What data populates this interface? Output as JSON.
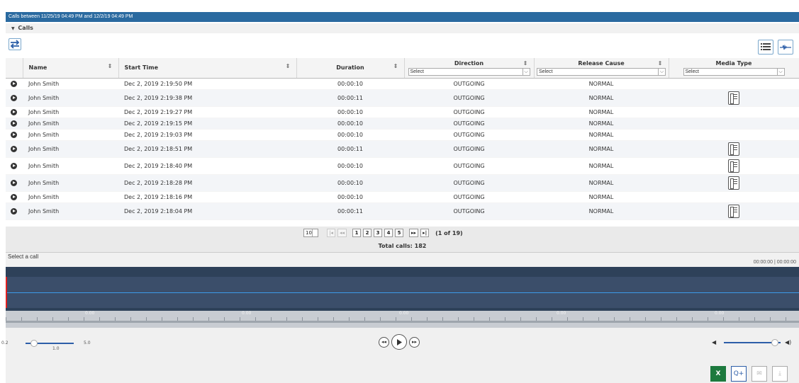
{
  "header": {
    "title": "Calls between 11/25/19 04:49 PM and 12/2/19 04:49 PM"
  },
  "section": {
    "label": "Calls"
  },
  "columns": {
    "name": "Name",
    "start_time": "Start Time",
    "duration": "Duration",
    "direction": "Direction",
    "release_cause": "Release Cause",
    "media_type": "Media Type"
  },
  "filters": {
    "direction": "Select",
    "release_cause": "Select",
    "media_type": "Select"
  },
  "rows": [
    {
      "name": "John Smith",
      "start": "Dec 2, 2019 2:19:50 PM",
      "duration": "00:00:10",
      "direction": "OUTGOING",
      "cause": "NORMAL",
      "media": ""
    },
    {
      "name": "John Smith",
      "start": "Dec 2, 2019 2:19:38 PM",
      "duration": "00:00:11",
      "direction": "OUTGOING",
      "cause": "NORMAL",
      "media": "phone-icon"
    },
    {
      "name": "John Smith",
      "start": "Dec 2, 2019 2:19:27 PM",
      "duration": "00:00:10",
      "direction": "OUTGOING",
      "cause": "NORMAL",
      "media": ""
    },
    {
      "name": "John Smith",
      "start": "Dec 2, 2019 2:19:15 PM",
      "duration": "00:00:10",
      "direction": "OUTGOING",
      "cause": "NORMAL",
      "media": ""
    },
    {
      "name": "John Smith",
      "start": "Dec 2, 2019 2:19:03 PM",
      "duration": "00:00:10",
      "direction": "OUTGOING",
      "cause": "NORMAL",
      "media": ""
    },
    {
      "name": "John Smith",
      "start": "Dec 2, 2019 2:18:51 PM",
      "duration": "00:00:11",
      "direction": "OUTGOING",
      "cause": "NORMAL",
      "media": "phone-icon"
    },
    {
      "name": "John Smith",
      "start": "Dec 2, 2019 2:18:40 PM",
      "duration": "00:00:10",
      "direction": "OUTGOING",
      "cause": "NORMAL",
      "media": "phone-icon"
    },
    {
      "name": "John Smith",
      "start": "Dec 2, 2019 2:18:28 PM",
      "duration": "00:00:10",
      "direction": "OUTGOING",
      "cause": "NORMAL",
      "media": "phone-icon"
    },
    {
      "name": "John Smith",
      "start": "Dec 2, 2019 2:18:16 PM",
      "duration": "00:00:10",
      "direction": "OUTGOING",
      "cause": "NORMAL",
      "media": ""
    },
    {
      "name": "John Smith",
      "start": "Dec 2, 2019 2:18:04 PM",
      "duration": "00:00:11",
      "direction": "OUTGOING",
      "cause": "NORMAL",
      "media": "phone-icon"
    }
  ],
  "pager": {
    "page_size": "10",
    "first": "|◂",
    "prev": "◂◂",
    "pages": [
      "1",
      "2",
      "3",
      "4",
      "5"
    ],
    "next": "▸▸",
    "last": "▸|",
    "info": "(1 of 19)",
    "total": "Total calls: 182"
  },
  "player": {
    "status": "Select a call",
    "time": "00:00:00 | 00:00:00",
    "ruler_labels": [
      "0.00",
      "0.00",
      "0.00",
      "0.00",
      "0.00"
    ],
    "speed": {
      "min": "0.2",
      "max": "5.0",
      "current": "1.0",
      "level": 0.17
    },
    "volume": {
      "level": 0.9
    }
  },
  "colors": {
    "title_bar": "#2a6aa0",
    "accent": "#2d5ea8",
    "waveform_bg": "#2e4159",
    "waveform_line": "#3d9be9",
    "cursor": "#e02020"
  }
}
